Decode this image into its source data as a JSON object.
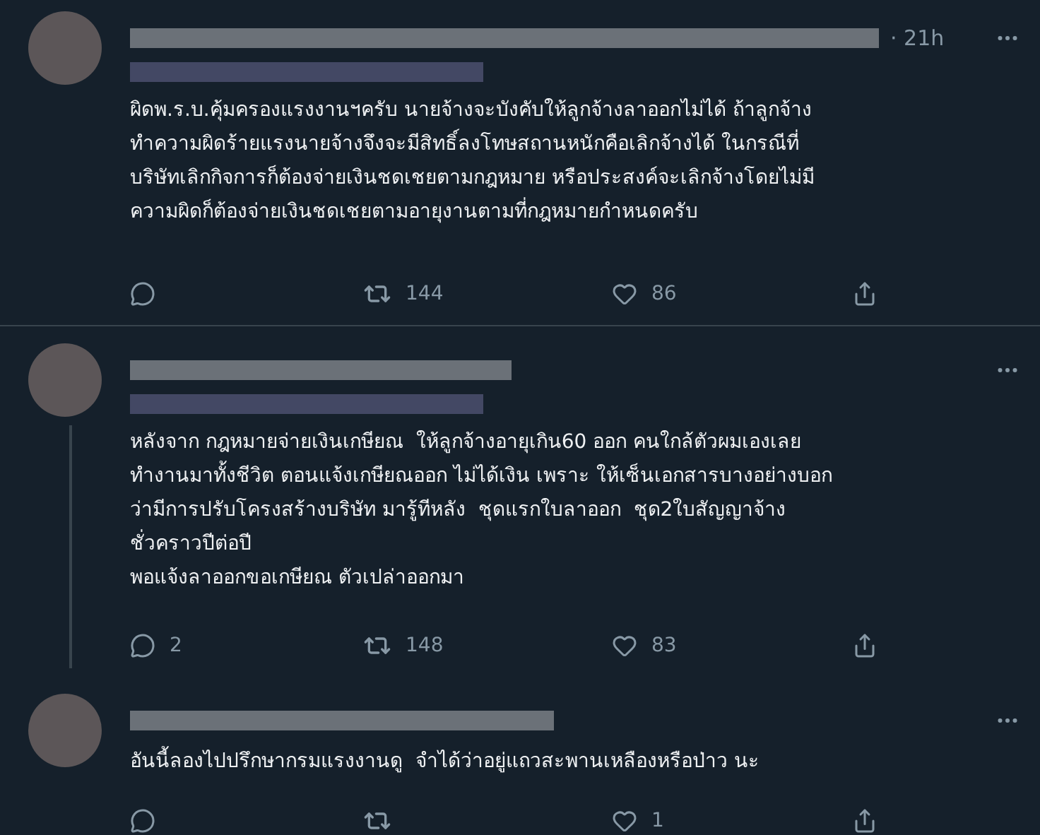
{
  "tweets": [
    {
      "time": "· 21h",
      "thread_line": false,
      "blurred_subline": true,
      "text": "ผิดพ.ร.บ.คุ้มครองแรงงานฯครับ นายจ้างจะบังคับให้ลูกจ้างลาออกไม่ได้ ถ้าลูกจ้าง\nทำความผิดร้ายแรงนายจ้างจึงจะมีสิทธิ์ลงโทษสถานหนักคือเลิกจ้างได้ ในกรณีที่\nบริษัทเลิกกิจการก็ต้องจ่ายเงินชดเชยตามกฎหมาย หรือประสงค์จะเลิกจ้างโดยไม่มี\nความผิดก็ต้องจ่ายเงินชดเชยตามอายุงานตามที่กฎหมายกำหนดครับ",
      "retweets": "144",
      "likes": "86"
    },
    {
      "thread_line": true,
      "blurred_subline": true,
      "text": "หลังจาก กฎหมายจ่ายเงินเกษียณ  ให้ลูกจ้างอายุเกิน60 ออก คนใกล้ตัวผมเองเลย\nทำงานมาทั้งชีวิต ตอนแจ้งเกษียณออก ไม่ได้เงิน เพราะ ให้เซ็นเอกสารบางอย่างบอก\nว่ามีการปรับโครงสร้างบริษัท มารู้ทีหลัง  ชุดแรกใบลาออก  ชุด2ใบสัญญาจ้าง\nชั่วคราวปีต่อปี\nพอแจ้งลาออกขอเกษียณ ตัวเปล่าออกมา",
      "replies": "2",
      "retweets": "148",
      "likes": "83"
    },
    {
      "thread_line": false,
      "blurred_subline": false,
      "text": "อันนี้ลองไปปรึกษากรมแรงงานดู  จำได้ว่าอยู่แถวสะพานเหลืองหรือป่าว นะ",
      "likes": "1"
    }
  ]
}
